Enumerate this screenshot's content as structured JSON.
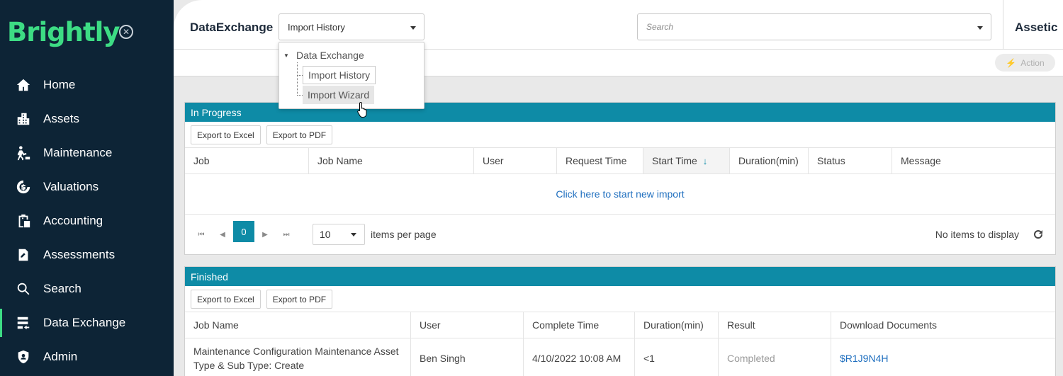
{
  "sidebar": {
    "logo_text": "Brightly",
    "collapse_icon": "close-circle-icon",
    "items": [
      {
        "label": "Home",
        "icon": "home-icon"
      },
      {
        "label": "Assets",
        "icon": "buildings-icon"
      },
      {
        "label": "Maintenance",
        "icon": "worker-icon"
      },
      {
        "label": "Valuations",
        "icon": "valuation-icon"
      },
      {
        "label": "Accounting",
        "icon": "clipboard-icon"
      },
      {
        "label": "Assessments",
        "icon": "assessment-icon"
      },
      {
        "label": "Search",
        "icon": "search-icon"
      },
      {
        "label": "Data Exchange",
        "icon": "data-exchange-icon",
        "active": true
      },
      {
        "label": "Admin",
        "icon": "shield-icon"
      }
    ],
    "accent_color": "#3ddc84",
    "bg_color": "#0d2436"
  },
  "header": {
    "app_title": "DataExchange",
    "module_select": "Import History",
    "search_placeholder": "Search",
    "org_name": "Assetic"
  },
  "toolbar": {
    "action_label": "Action"
  },
  "dropdown": {
    "root": "Data Exchange",
    "items": [
      "Import History",
      "Import Wizard"
    ]
  },
  "in_progress": {
    "title": "In Progress",
    "export_excel": "Export to Excel",
    "export_pdf": "Export to PDF",
    "columns": [
      "Job",
      "Job Name",
      "User",
      "Request Time",
      "Start Time",
      "Duration(min)",
      "Status",
      "Message"
    ],
    "empty_link": "Click here to start new import",
    "pager": {
      "current_page": "0",
      "page_size": "10",
      "items_per_page": "items per page",
      "info": "No items to display"
    }
  },
  "finished": {
    "title": "Finished",
    "export_excel": "Export to Excel",
    "export_pdf": "Export to PDF",
    "columns": [
      "Job Name",
      "User",
      "Complete Time",
      "Duration(min)",
      "Result",
      "Download Documents"
    ],
    "rows": [
      {
        "job_name": "Maintenance Configuration Maintenance Asset Type & Sub Type: Create",
        "user": "Ben Singh",
        "complete_time": "4/10/2022 10:08 AM",
        "duration": "<1",
        "result": "Completed",
        "document": "$R1J9N4H"
      }
    ]
  },
  "theme": {
    "panel_header": "#0e8ba6",
    "link": "#1f6fbf"
  }
}
